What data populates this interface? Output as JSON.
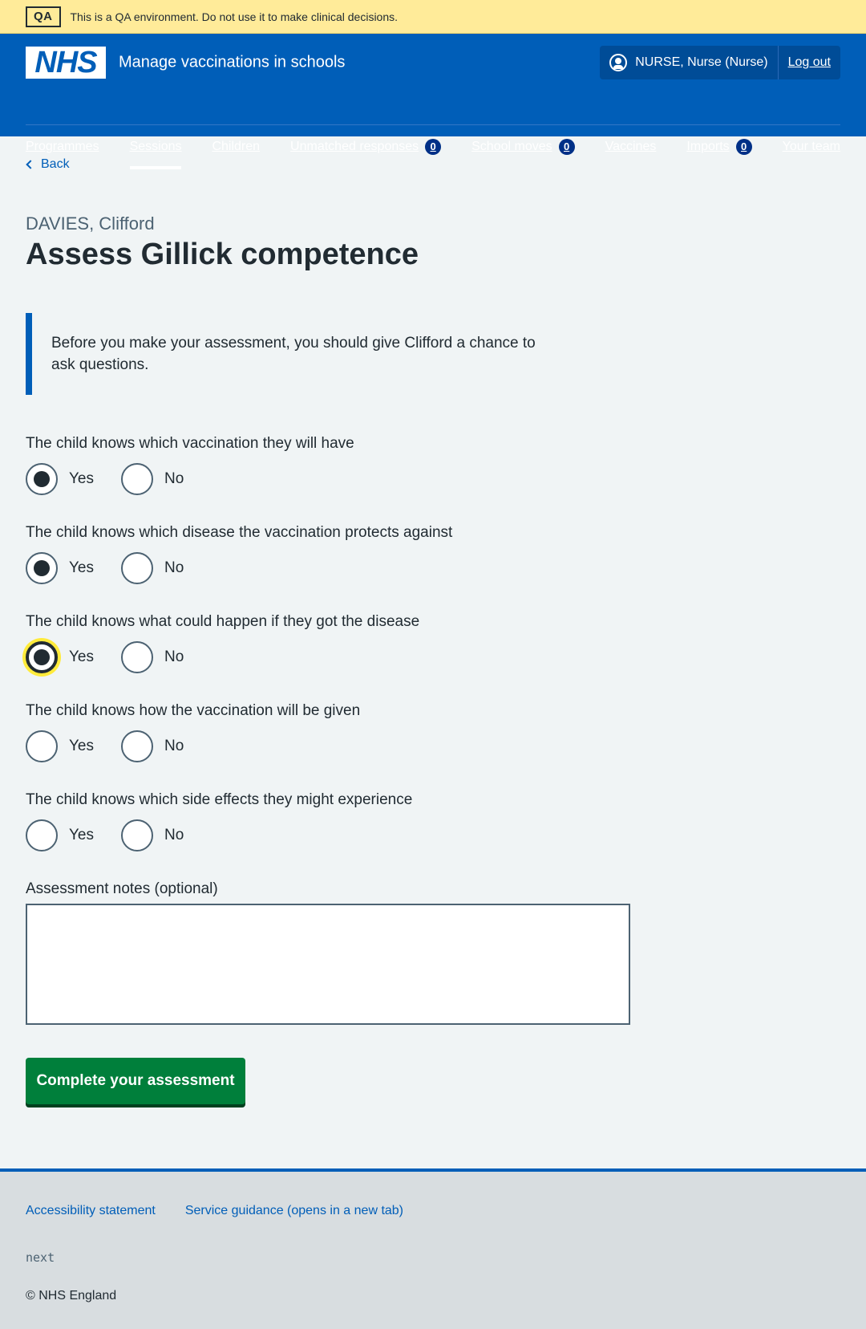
{
  "qa_banner": {
    "tag": "QA",
    "text": "This is a QA environment. Do not use it to make clinical decisions."
  },
  "header": {
    "logo": "NHS",
    "service_name": "Manage vaccinations in schools",
    "user": "NURSE, Nurse (Nurse)",
    "logout": "Log out",
    "nav": [
      {
        "label": "Programmes"
      },
      {
        "label": "Sessions",
        "active": true
      },
      {
        "label": "Children"
      },
      {
        "label": "Unmatched responses",
        "badge": "0"
      },
      {
        "label": "School moves",
        "badge": "0"
      },
      {
        "label": "Vaccines"
      },
      {
        "label": "Imports",
        "badge": "0"
      },
      {
        "label": "Your team"
      }
    ]
  },
  "back": "Back",
  "caption": "DAVIES, Clifford",
  "title": "Assess Gillick competence",
  "inset": "Before you make your assessment, you should give Clifford a chance to ask questions.",
  "questions": [
    {
      "label": "The child knows which vaccination they will have",
      "yes": "Yes",
      "no": "No",
      "selected": "yes"
    },
    {
      "label": "The child knows which disease the vaccination protects against",
      "yes": "Yes",
      "no": "No",
      "selected": "yes"
    },
    {
      "label": "The child knows what could happen if they got the disease",
      "yes": "Yes",
      "no": "No",
      "selected": "yes"
    },
    {
      "label": "The child knows how the vaccination will be given",
      "yes": "Yes",
      "no": "No",
      "selected": ""
    },
    {
      "label": "The child knows which side effects they might experience",
      "yes": "Yes",
      "no": "No",
      "selected": ""
    }
  ],
  "notes_label": "Assessment notes (optional)",
  "notes_value": "",
  "submit": "Complete your assessment",
  "footer": {
    "links": [
      "Accessibility statement",
      "Service guidance (opens in a new tab)"
    ],
    "version": "next",
    "copyright": "© NHS England"
  }
}
